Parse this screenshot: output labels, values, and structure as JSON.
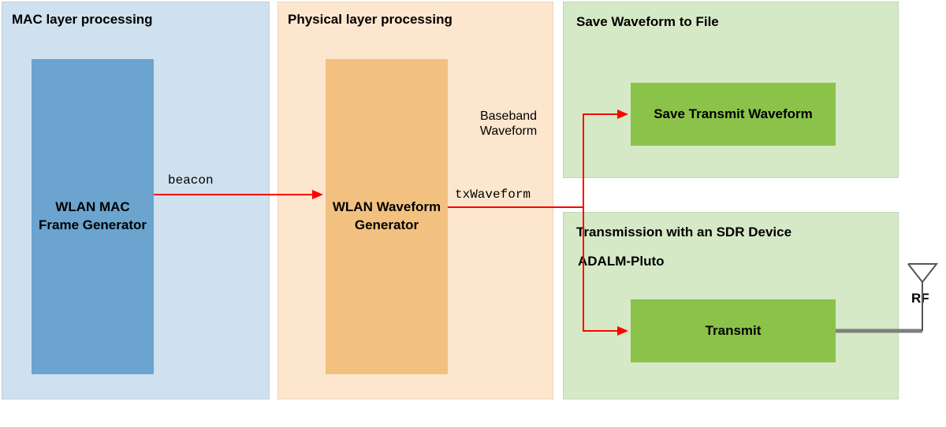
{
  "panels": {
    "mac": {
      "title": "MAC layer processing"
    },
    "phy": {
      "title": "Physical layer processing"
    },
    "save": {
      "title": "Save Waveform to File"
    },
    "sdr": {
      "title": "Transmission with an SDR Device"
    }
  },
  "blocks": {
    "mac_gen": "WLAN MAC Frame Generator",
    "phy_gen": "WLAN Waveform Generator",
    "save_btn": "Save Transmit Waveform",
    "tx_btn": "Transmit"
  },
  "labels": {
    "beacon": "beacon",
    "txwaveform": "txWaveform",
    "baseband": "Baseband Waveform",
    "adalm": "ADALM-Pluto",
    "rf": "RF"
  },
  "colors": {
    "arrow": "#ff0000",
    "rf_line": "#7f7f7f"
  }
}
